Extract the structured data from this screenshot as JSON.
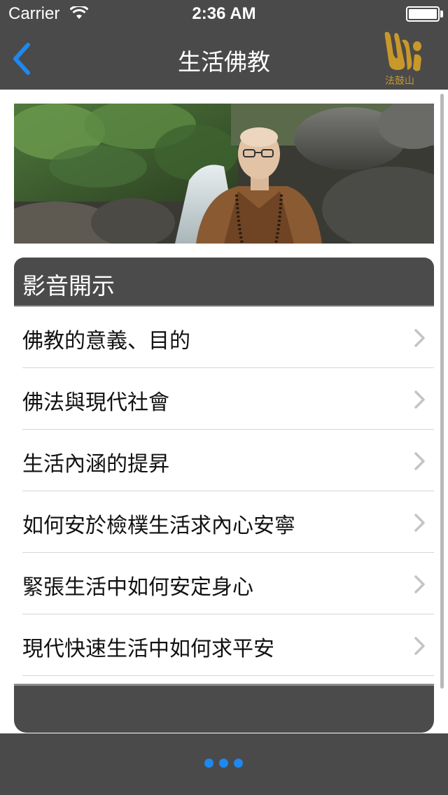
{
  "status_bar": {
    "carrier": "Carrier",
    "time": "2:36 AM",
    "wifi_icon": "wifi-icon",
    "battery_icon": "battery-icon"
  },
  "nav": {
    "title": "生活佛教",
    "back_icon": "chevron-left-icon",
    "logo_text": "法鼓山"
  },
  "hero": {
    "image": "monk-by-waterfall-photo"
  },
  "section": {
    "title": "影音開示",
    "items": [
      {
        "label": "佛教的意義、目的"
      },
      {
        "label": "佛法與現代社會"
      },
      {
        "label": "生活內涵的提昇"
      },
      {
        "label": "如何安於檢樸生活求內心安寧"
      },
      {
        "label": "緊張生活中如何安定身心"
      },
      {
        "label": "現代快速生活中如何求平安"
      }
    ]
  },
  "bottom_bar": {
    "more_icon": "more-dots-icon"
  },
  "colors": {
    "bar": "#4a4a4a",
    "accent": "#1e88f0",
    "logo_gold": "#c8982a"
  }
}
